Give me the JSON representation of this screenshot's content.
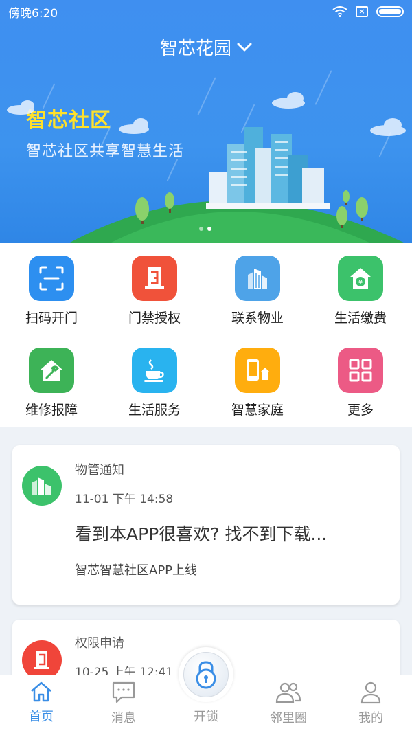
{
  "status_bar": {
    "time": "傍晚6:20"
  },
  "header": {
    "location": "智芯花园"
  },
  "banner": {
    "title": "智芯社区",
    "subtitle": "智芯社区共享智慧生活",
    "page_count": 2,
    "active_page": 2
  },
  "colors": {
    "primary": "#3a8ee6",
    "banner_title": "#ffe12b",
    "background": "#eef2f7"
  },
  "services": [
    {
      "label": "扫码开门",
      "icon": "scan-icon",
      "color": "#2d8ff0"
    },
    {
      "label": "门禁授权",
      "icon": "door-auth-icon",
      "color": "#f0523a"
    },
    {
      "label": "联系物业",
      "icon": "building-icon",
      "color": "#4ea3e8"
    },
    {
      "label": "生活缴费",
      "icon": "payment-icon",
      "color": "#3cc26b"
    },
    {
      "label": "维修报障",
      "icon": "repair-icon",
      "color": "#3db357"
    },
    {
      "label": "生活服务",
      "icon": "coffee-icon",
      "color": "#29b3ef"
    },
    {
      "label": "智慧家庭",
      "icon": "smart-home-icon",
      "color": "#ffad0e"
    },
    {
      "label": "更多",
      "icon": "more-grid-icon",
      "color": "#ec5a85"
    }
  ],
  "notices": [
    {
      "title": "物管通知",
      "time": "11-01 下午 14:58",
      "headline": "看到本APP很喜欢? 找不到下载...",
      "body": "智芯智慧社区APP上线",
      "avatar_color": "#3cc26b"
    },
    {
      "title": "权限申请",
      "time": "10-25 上午 12:41",
      "avatar_color": "#f0453a"
    }
  ],
  "tabbar": {
    "tabs": [
      {
        "label": "首页",
        "icon": "home-icon",
        "active": true
      },
      {
        "label": "消息",
        "icon": "message-icon",
        "active": false
      },
      {
        "label": "开锁",
        "icon": "lock-icon",
        "active": false
      },
      {
        "label": "邻里圈",
        "icon": "people-icon",
        "active": false
      },
      {
        "label": "我的",
        "icon": "user-icon",
        "active": false
      }
    ]
  }
}
